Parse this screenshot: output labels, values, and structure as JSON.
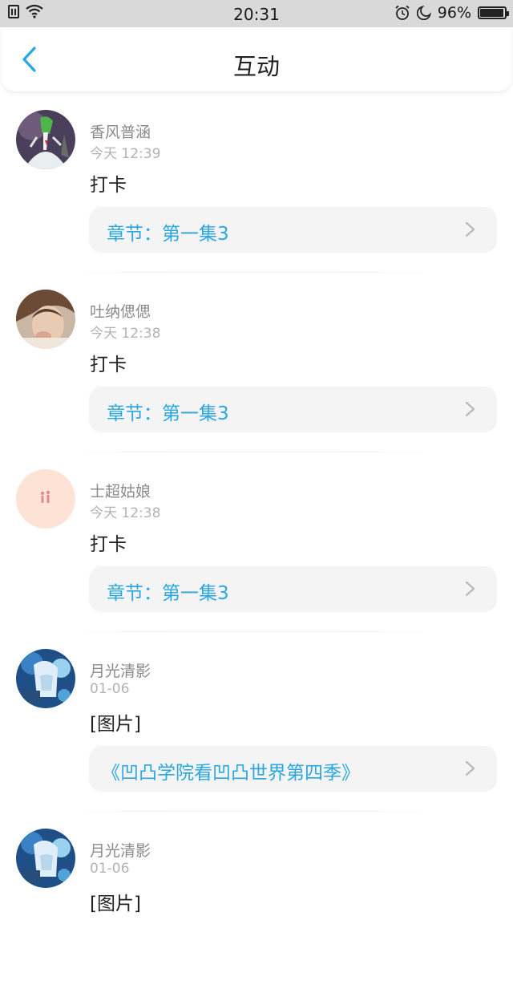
{
  "status_bar": {
    "time": "20:31",
    "battery": "96%",
    "battery_level": 0.96
  },
  "header": {
    "title": "互动"
  },
  "feed": [
    {
      "username": "香风普涵",
      "time": "今天 12:39",
      "message": "打卡",
      "chapter": "章节：第一集3",
      "avatar": "gardevoir-avatar"
    },
    {
      "username": "吐纳偲偲",
      "time": "今天 12:38",
      "message": "打卡",
      "chapter": "章节：第一集3",
      "avatar": "portrait-avatar"
    },
    {
      "username": "士超姑娘",
      "time": "今天 12:38",
      "message": "打卡",
      "chapter": "章节：第一集3",
      "avatar": "couple-avatar"
    },
    {
      "username": "月光清影",
      "time": "01-06",
      "message": "[图片]",
      "chapter": "《凹凸学院看凹凸世界第四季》",
      "avatar": "anime-avatar"
    },
    {
      "username": "月光清影",
      "time": "01-06",
      "message": "[图片]",
      "chapter": "",
      "avatar": "anime-avatar"
    }
  ],
  "colors": {
    "accent": "#2aa6e0",
    "card_bg": "#f4f4f4",
    "status_bar_bg": "#d9d9d9"
  }
}
